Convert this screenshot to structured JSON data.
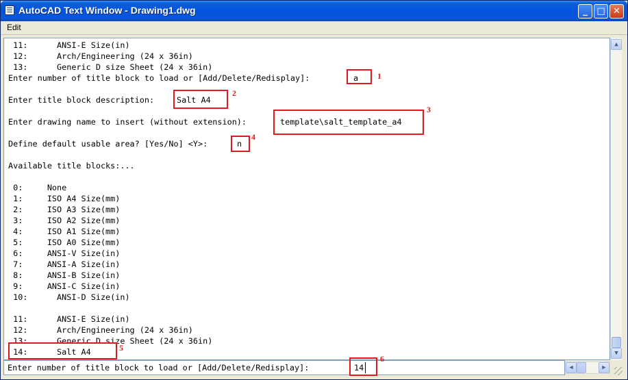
{
  "window": {
    "title": "AutoCAD Text Window - Drawing1.dwg",
    "minimize_label": "_",
    "maximize_label": "□",
    "close_label": "✕"
  },
  "menu": {
    "edit_label": "Edit"
  },
  "console_lines": [
    " 11:      ANSI-E Size(in)",
    " 12:      Arch/Engineering (24 x 36in)",
    " 13:      Generic D size Sheet (24 x 36in)",
    "Enter number of title block to load or [Add/Delete/Redisplay]:",
    "Enter title block description:",
    "Enter drawing name to insert (without extension):",
    "Define default usable area? [Yes/No] <Y>:",
    "Available title blocks:...",
    " 0:     None",
    " 1:     ISO A4 Size(mm)",
    " 2:     ISO A3 Size(mm)",
    " 3:     ISO A2 Size(mm)",
    " 4:     ISO A1 Size(mm)",
    " 5:     ISO A0 Size(mm)",
    " 6:     ANSI-V Size(in)",
    " 7:     ANSI-A Size(in)",
    " 8:     ANSI-B Size(in)",
    " 9:     ANSI-C Size(in)",
    " 10:      ANSI-D Size(in)",
    " 11:      ANSI-E Size(in)",
    " 12:      Arch/Engineering (24 x 36in)",
    " 13:      Generic D size Sheet (24 x 36in)",
    " 14:      Salt A4"
  ],
  "inputs": {
    "answer_1": "a",
    "answer_2": "Salt A4",
    "answer_3": "template\\salt_template_a4",
    "answer_4": "n"
  },
  "command_line": {
    "prompt": "Enter number of title block to load or [Add/Delete/Redisplay]:",
    "value": "14"
  },
  "annotations": {
    "labels": [
      "1",
      "2",
      "3",
      "4",
      "5",
      "6"
    ],
    "color": "#e0171c"
  },
  "colors": {
    "titlebar": "#0454e0",
    "console_bg": "#ffffff",
    "chrome": "#ece9d8"
  }
}
